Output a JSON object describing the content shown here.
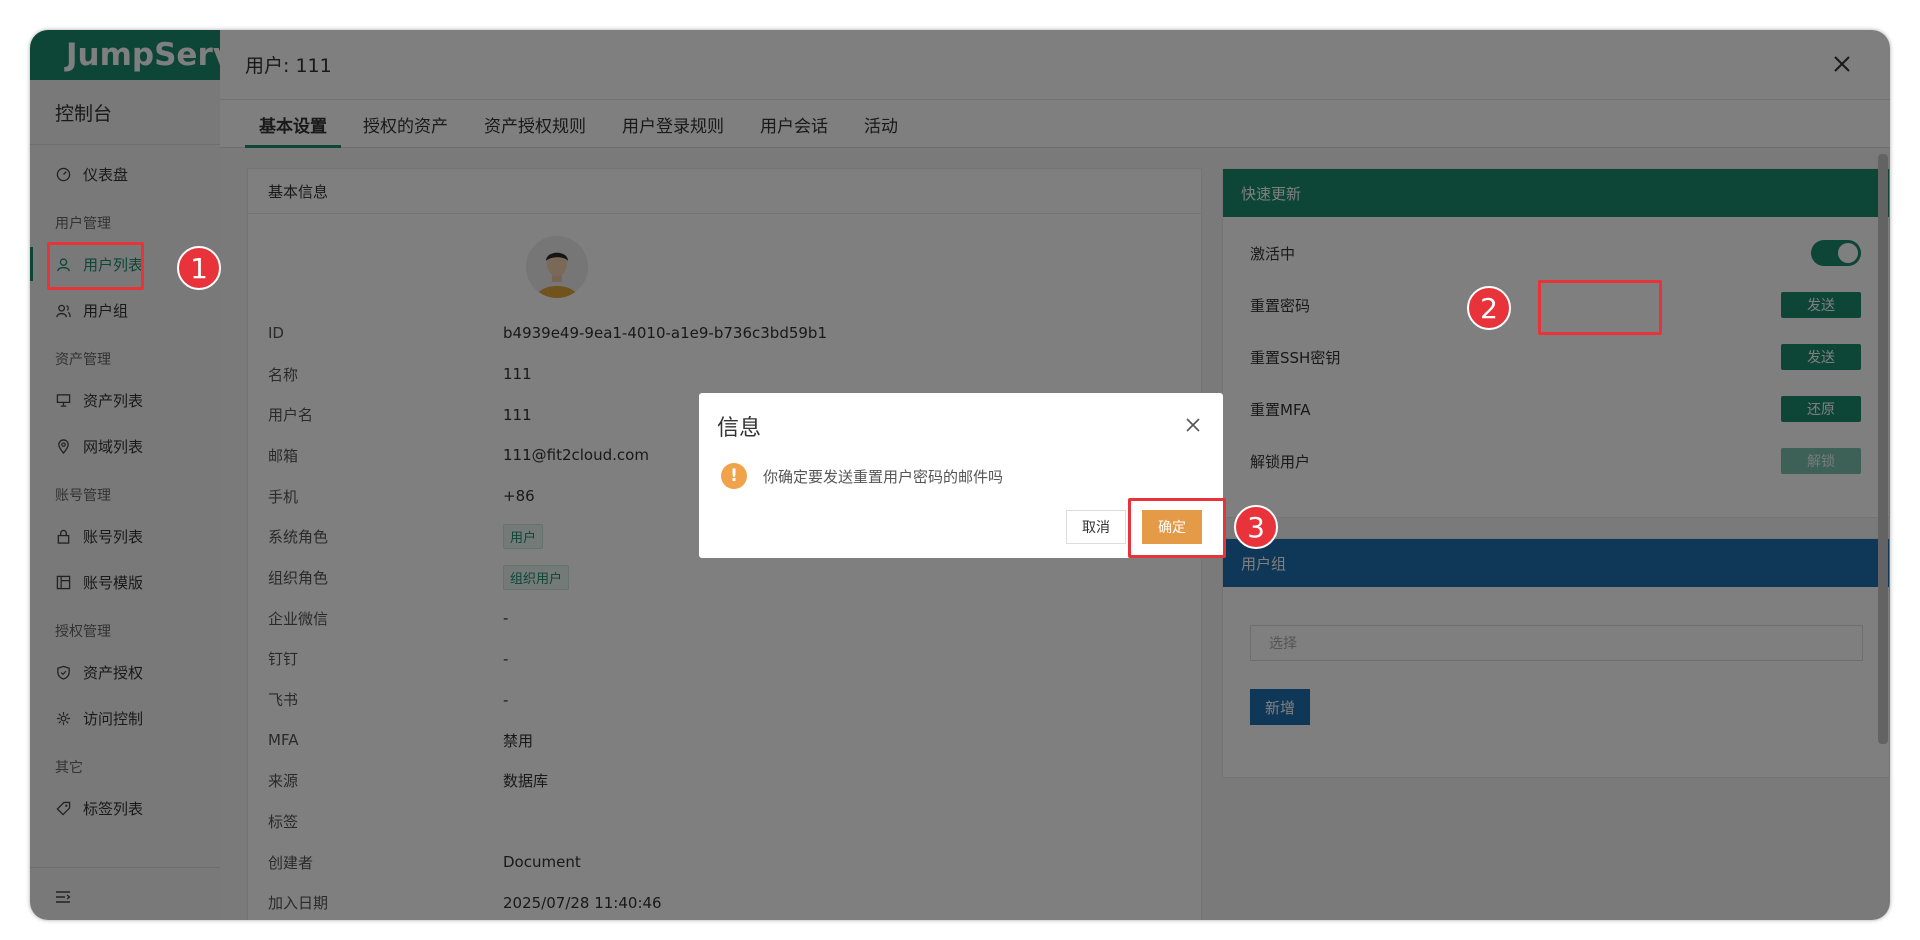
{
  "app": {
    "logo_text": "JumpServer"
  },
  "sidebar": {
    "console_label": "控制台",
    "groups": [
      {
        "title": "",
        "items": [
          {
            "label": "仪表盘",
            "icon": "dashboard-icon"
          }
        ]
      },
      {
        "title": "用户管理",
        "items": [
          {
            "label": "用户列表",
            "icon": "user-icon",
            "active": true
          },
          {
            "label": "用户组",
            "icon": "users-icon"
          }
        ]
      },
      {
        "title": "资产管理",
        "items": [
          {
            "label": "资产列表",
            "icon": "server-icon"
          },
          {
            "label": "网域列表",
            "icon": "location-icon"
          }
        ]
      },
      {
        "title": "账号管理",
        "items": [
          {
            "label": "账号列表",
            "icon": "lock-icon"
          },
          {
            "label": "账号模版",
            "icon": "template-icon"
          }
        ]
      },
      {
        "title": "授权管理",
        "items": [
          {
            "label": "资产授权",
            "icon": "shield-icon"
          },
          {
            "label": "访问控制",
            "icon": "access-icon"
          }
        ]
      },
      {
        "title": "其它",
        "items": [
          {
            "label": "标签列表",
            "icon": "tag-icon"
          }
        ]
      }
    ]
  },
  "drawer": {
    "title": "用户: 111",
    "tabs": [
      "基本设置",
      "授权的资产",
      "资产授权规则",
      "用户登录规则",
      "用户会话",
      "活动"
    ],
    "active_tab": 0
  },
  "basic_info": {
    "title": "基本信息",
    "rows": [
      {
        "key": "ID",
        "value": "b4939e49-9ea1-4010-a1e9-b736c3bd59b1"
      },
      {
        "key": "名称",
        "value": "111"
      },
      {
        "key": "用户名",
        "value": "111"
      },
      {
        "key": "邮箱",
        "value": "111@fit2cloud.com"
      },
      {
        "key": "手机",
        "value": "+86"
      },
      {
        "key": "系统角色",
        "value": "用户",
        "tag": true
      },
      {
        "key": "组织角色",
        "value": "组织用户",
        "tag": true
      },
      {
        "key": "企业微信",
        "value": "-"
      },
      {
        "key": "钉钉",
        "value": "-"
      },
      {
        "key": "飞书",
        "value": "-"
      },
      {
        "key": "MFA",
        "value": "禁用"
      },
      {
        "key": "来源",
        "value": "数据库"
      },
      {
        "key": "标签",
        "value": ""
      },
      {
        "key": "创建者",
        "value": "Document"
      },
      {
        "key": "加入日期",
        "value": "2025/07/28 11:40:46"
      }
    ]
  },
  "quick_update": {
    "title": "快速更新",
    "rows": [
      {
        "label": "激活中",
        "control": "toggle",
        "on": true
      },
      {
        "label": "重置密码",
        "control": "button",
        "button": "发送"
      },
      {
        "label": "重置SSH密钥",
        "control": "button",
        "button": "发送"
      },
      {
        "label": "重置MFA",
        "control": "button",
        "button": "还原"
      },
      {
        "label": "解锁用户",
        "control": "button",
        "button": "解锁",
        "disabled": true
      }
    ]
  },
  "user_group": {
    "title": "用户组",
    "select_placeholder": "选择",
    "add_button": "新增"
  },
  "modal": {
    "title": "信息",
    "message": "你确定要发送重置用户密码的邮件吗",
    "cancel": "取消",
    "confirm": "确定"
  },
  "annotations": [
    "1",
    "2",
    "3"
  ],
  "colors": {
    "primary": "#1a8a6f",
    "blue": "#1f6fae",
    "warning": "#e59a48",
    "annotation": "#e8333a"
  }
}
